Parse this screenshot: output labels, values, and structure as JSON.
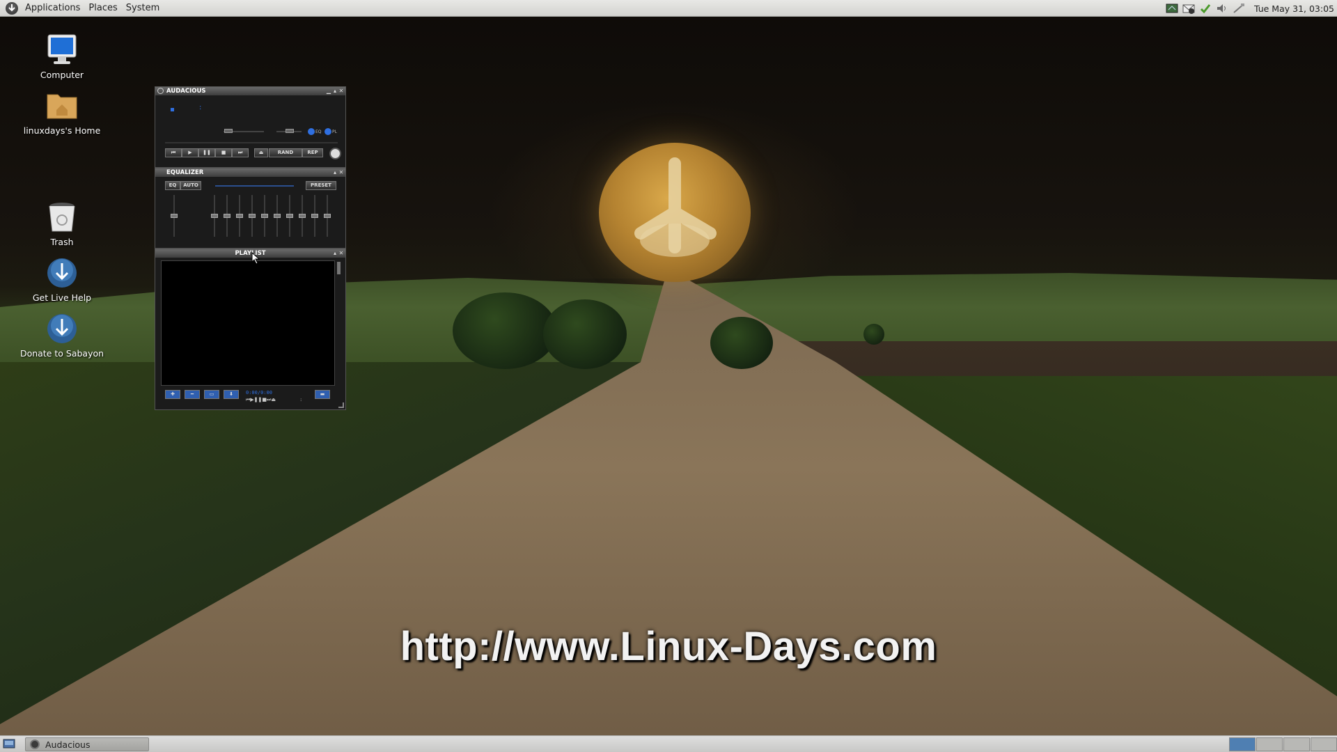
{
  "top_panel": {
    "menus": [
      "Applications",
      "Places",
      "System"
    ],
    "clock": "Tue May 31, 03:05",
    "tray_icons": [
      "network-icon",
      "mail-icon",
      "update-ok-icon",
      "volume-icon",
      "network-wired-icon"
    ]
  },
  "desktop_icons": [
    {
      "label": "Computer",
      "icon": "computer-icon"
    },
    {
      "label": "linuxdays's Home",
      "icon": "home-folder-icon"
    },
    {
      "label": "Trash",
      "icon": "trash-icon"
    },
    {
      "label": "Get Live Help",
      "icon": "sabayon-help-icon"
    },
    {
      "label": "Donate to Sabayon",
      "icon": "sabayon-donate-icon"
    }
  ],
  "wallpaper": {
    "watermark": "http://www.Linux-Days.com"
  },
  "audacious": {
    "main": {
      "title": "AUDACIOUS",
      "time_separator": ":",
      "buttons": {
        "rand": "RAND",
        "rep": "REP",
        "eq": "EQ",
        "pl": "PL"
      }
    },
    "equalizer": {
      "title": "EQUALIZER",
      "eq": "EQ",
      "auto": "AUTO",
      "preset": "PRESET",
      "band_levels": [
        0.5,
        0.5,
        0.5,
        0.5,
        0.5,
        0.5,
        0.5,
        0.5,
        0.5,
        0.5,
        0.5
      ]
    },
    "playlist": {
      "title": "PLAYLIST",
      "time": "0:00/0:00",
      "colon": ":"
    }
  },
  "bottom_panel": {
    "task": "Audacious",
    "workspaces": 4,
    "active_workspace": 1
  },
  "colors": {
    "aud_text": "#2f6fe0",
    "panel_bg": "#d9d9d6"
  }
}
